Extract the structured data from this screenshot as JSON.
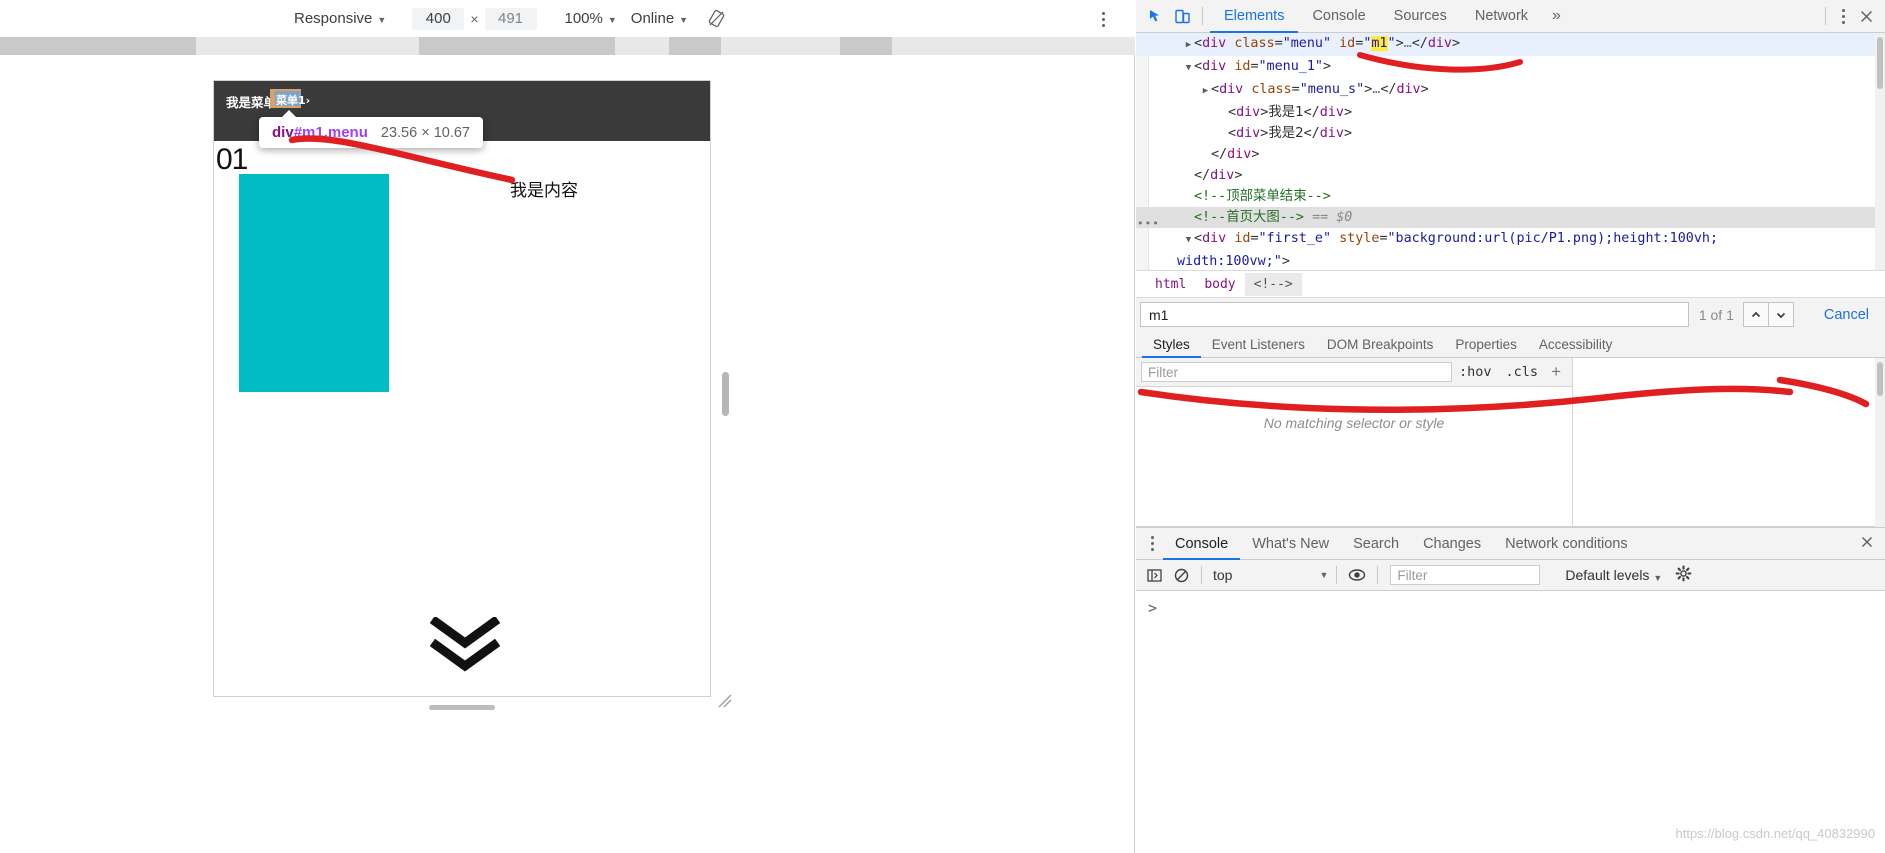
{
  "device_toolbar": {
    "device": "Responsive",
    "width": "400",
    "height": "491",
    "zoom": "100%",
    "throttling": "Online",
    "x_separator": "×",
    "rotate_icon": "rotate-device-icon",
    "kebab_icon": "more-options-icon"
  },
  "page_preview": {
    "menu_label": "我是菜单",
    "highlighted_item": "菜单1›",
    "tooltip": {
      "selector_tag": "div",
      "selector_rest": "#m1.menu",
      "dimensions": "23.56 × 10.67"
    },
    "section_number": "01",
    "content_text": "我是内容",
    "chevron_icon": "chevron-double-down-icon"
  },
  "devtools": {
    "toolbar_icons": {
      "inspect": "inspect-element-icon",
      "device_toggle": "toggle-device-toolbar-icon",
      "kebab": "customize-devtools-icon",
      "close": "close-devtools-icon"
    },
    "tabs": [
      {
        "label": "Elements",
        "active": true
      },
      {
        "label": "Console",
        "active": false
      },
      {
        "label": "Sources",
        "active": false
      },
      {
        "label": "Network",
        "active": false
      }
    ],
    "more_tabs_icon": "»",
    "dom_tree": [
      {
        "indent": 2,
        "twisty": "▶",
        "state": "selected",
        "parts": [
          {
            "t": "punct",
            "v": "<"
          },
          {
            "t": "tag",
            "v": "div"
          },
          {
            "t": "punct",
            "v": " "
          },
          {
            "t": "attr",
            "v": "class"
          },
          {
            "t": "punct",
            "v": "="
          },
          {
            "t": "val",
            "v": "\"menu\""
          },
          {
            "t": "punct",
            "v": " "
          },
          {
            "t": "attr",
            "v": "id"
          },
          {
            "t": "punct",
            "v": "="
          },
          {
            "t": "val",
            "v": "\""
          },
          {
            "t": "mark",
            "v": "m1"
          },
          {
            "t": "val",
            "v": "\""
          },
          {
            "t": "punct",
            "v": ">"
          },
          {
            "t": "ellip",
            "v": "…"
          },
          {
            "t": "punct",
            "v": "</"
          },
          {
            "t": "tag",
            "v": "div"
          },
          {
            "t": "punct",
            "v": ">"
          }
        ]
      },
      {
        "indent": 2,
        "twisty": "▼",
        "state": "",
        "parts": [
          {
            "t": "punct",
            "v": "<"
          },
          {
            "t": "tag",
            "v": "div"
          },
          {
            "t": "punct",
            "v": " "
          },
          {
            "t": "attr",
            "v": "id"
          },
          {
            "t": "punct",
            "v": "="
          },
          {
            "t": "val",
            "v": "\"menu_1\""
          },
          {
            "t": "punct",
            "v": ">"
          }
        ]
      },
      {
        "indent": 3,
        "twisty": "▶",
        "state": "",
        "parts": [
          {
            "t": "punct",
            "v": "<"
          },
          {
            "t": "tag",
            "v": "div"
          },
          {
            "t": "punct",
            "v": " "
          },
          {
            "t": "attr",
            "v": "class"
          },
          {
            "t": "punct",
            "v": "="
          },
          {
            "t": "val",
            "v": "\"menu_s\""
          },
          {
            "t": "punct",
            "v": ">"
          },
          {
            "t": "ellip",
            "v": "…"
          },
          {
            "t": "punct",
            "v": "</"
          },
          {
            "t": "tag",
            "v": "div"
          },
          {
            "t": "punct",
            "v": ">"
          }
        ]
      },
      {
        "indent": 4,
        "twisty": "",
        "state": "",
        "parts": [
          {
            "t": "punct",
            "v": "<"
          },
          {
            "t": "tag",
            "v": "div"
          },
          {
            "t": "punct",
            "v": ">"
          },
          {
            "t": "cn",
            "v": "我是1"
          },
          {
            "t": "punct",
            "v": "</"
          },
          {
            "t": "tag",
            "v": "div"
          },
          {
            "t": "punct",
            "v": ">"
          }
        ]
      },
      {
        "indent": 4,
        "twisty": "",
        "state": "",
        "parts": [
          {
            "t": "punct",
            "v": "<"
          },
          {
            "t": "tag",
            "v": "div"
          },
          {
            "t": "punct",
            "v": ">"
          },
          {
            "t": "cn",
            "v": "我是2"
          },
          {
            "t": "punct",
            "v": "</"
          },
          {
            "t": "tag",
            "v": "div"
          },
          {
            "t": "punct",
            "v": ">"
          }
        ]
      },
      {
        "indent": 3,
        "twisty": "",
        "state": "",
        "parts": [
          {
            "t": "punct",
            "v": "</"
          },
          {
            "t": "tag",
            "v": "div"
          },
          {
            "t": "punct",
            "v": ">"
          }
        ]
      },
      {
        "indent": 2,
        "twisty": "",
        "state": "",
        "parts": [
          {
            "t": "punct",
            "v": "</"
          },
          {
            "t": "tag",
            "v": "div"
          },
          {
            "t": "punct",
            "v": ">"
          }
        ]
      },
      {
        "indent": 2,
        "twisty": "",
        "state": "",
        "parts": [
          {
            "t": "cmt",
            "v": "<!--顶部菜单结束-->"
          }
        ]
      },
      {
        "indent": 2,
        "twisty": "",
        "state": "marked",
        "dots": true,
        "parts": [
          {
            "t": "cmt",
            "v": "<!--首页大图-->"
          },
          {
            "t": "punct",
            "v": " "
          },
          {
            "t": "dollar",
            "v": "== $0"
          }
        ]
      },
      {
        "indent": 2,
        "twisty": "▼",
        "state": "",
        "parts": [
          {
            "t": "punct",
            "v": "<"
          },
          {
            "t": "tag",
            "v": "div"
          },
          {
            "t": "punct",
            "v": " "
          },
          {
            "t": "attr",
            "v": "id"
          },
          {
            "t": "punct",
            "v": "="
          },
          {
            "t": "val",
            "v": "\"first_e\""
          },
          {
            "t": "punct",
            "v": " "
          },
          {
            "t": "attr",
            "v": "style"
          },
          {
            "t": "punct",
            "v": "="
          },
          {
            "t": "val",
            "v": "\"background:url(pic/P1.png);height:100vh;"
          }
        ]
      },
      {
        "indent": 1,
        "twisty": "",
        "state": "",
        "parts": [
          {
            "t": "val",
            "v": "width:100vw;\""
          },
          {
            "t": "punct",
            "v": ">"
          }
        ]
      }
    ],
    "breadcrumbs": [
      {
        "label": "html",
        "active": false
      },
      {
        "label": "body",
        "active": false
      },
      {
        "label": "<!-->",
        "active": true
      }
    ],
    "search": {
      "value": "m1",
      "count": "1 of 1",
      "prev_icon": "chevron-up-icon",
      "next_icon": "chevron-down-icon",
      "cancel_label": "Cancel"
    },
    "styles_tabs": [
      {
        "label": "Styles",
        "active": true
      },
      {
        "label": "Event Listeners",
        "active": false
      },
      {
        "label": "DOM Breakpoints",
        "active": false
      },
      {
        "label": "Properties",
        "active": false
      },
      {
        "label": "Accessibility",
        "active": false
      }
    ],
    "styles_pane": {
      "filter_placeholder": "Filter",
      "hov_label": ":hov",
      "cls_label": ".cls",
      "new_rule_icon": "add-new-style-rule-icon",
      "empty_message": "No matching selector or style"
    },
    "drawer_tabs": [
      {
        "label": "Console",
        "active": true
      },
      {
        "label": "What's New",
        "active": false
      },
      {
        "label": "Search",
        "active": false
      },
      {
        "label": "Changes",
        "active": false
      },
      {
        "label": "Network conditions",
        "active": false
      }
    ],
    "drawer_close_icon": "close-drawer-icon",
    "console_toolbar": {
      "sidebar_icon": "console-sidebar-icon",
      "clear_icon": "clear-console-icon",
      "context": "top",
      "eye_icon": "live-expression-icon",
      "filter_placeholder": "Filter",
      "levels": "Default levels",
      "settings_icon": "console-settings-icon"
    },
    "console_prompt": ">"
  },
  "watermark": "https://blog.csdn.net/qq_40832990"
}
